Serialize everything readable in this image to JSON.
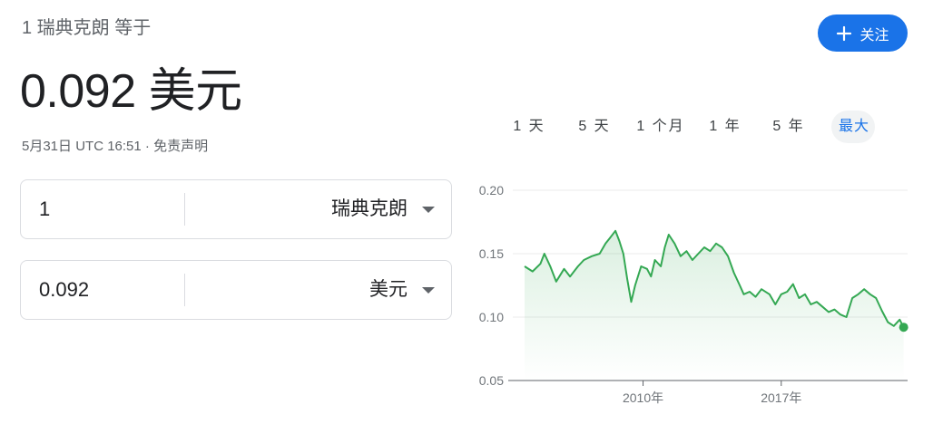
{
  "header": {
    "line": "1 瑞典克朗 等于",
    "rate_value": "0.092",
    "rate_currency": "美元",
    "timestamp": "5月31日 UTC 16:51",
    "separator": " · ",
    "disclaimer": "免责声明"
  },
  "follow_button": {
    "icon": "plus-icon",
    "label": "关注"
  },
  "tabs": [
    {
      "label": "1 天"
    },
    {
      "label": "5 天"
    },
    {
      "label": "1 个月"
    },
    {
      "label": "1 年"
    },
    {
      "label": "5 年"
    },
    {
      "label": "最大",
      "active": true
    }
  ],
  "converter": {
    "from": {
      "amount": "1",
      "currency": "瑞典克朗"
    },
    "to": {
      "amount": "0.092",
      "currency": "美元"
    }
  },
  "colors": {
    "accent": "#1a73e8",
    "line": "#34a853",
    "text": "#202124",
    "muted": "#5f6368"
  },
  "chart_data": {
    "type": "area",
    "y_ticks": [
      "0.20",
      "0.15",
      "0.10",
      "0.05"
    ],
    "x_ticks": [
      "2010年",
      "2017年"
    ],
    "ylim": [
      0.05,
      0.2
    ],
    "xlim": [
      2003.4,
      2023.4
    ],
    "grid": true,
    "series": [
      {
        "x": [
          2004.0,
          2004.4,
          2004.8,
          2005.0,
          2005.3,
          2005.6,
          2006.0,
          2006.3,
          2006.7,
          2007.0,
          2007.4,
          2007.8,
          2008.1,
          2008.3,
          2008.6,
          2008.8,
          2009.0,
          2009.2,
          2009.4,
          2009.6,
          2009.9,
          2010.2,
          2010.4,
          2010.6,
          2010.9,
          2011.1,
          2011.3,
          2011.6,
          2011.9,
          2012.2,
          2012.5,
          2012.8,
          2013.1,
          2013.4,
          2013.7,
          2014.0,
          2014.3,
          2014.6,
          2014.9,
          2015.1,
          2015.4,
          2015.7,
          2016.0,
          2016.4,
          2016.7,
          2017.0,
          2017.3,
          2017.6,
          2017.9,
          2018.2,
          2018.5,
          2018.8,
          2019.1,
          2019.4,
          2019.7,
          2020.0,
          2020.3,
          2020.6,
          2020.9,
          2021.2,
          2021.5,
          2021.8,
          2022.1,
          2022.4,
          2022.7,
          2023.0,
          2023.2
        ],
        "values": [
          0.14,
          0.136,
          0.142,
          0.15,
          0.14,
          0.128,
          0.138,
          0.132,
          0.14,
          0.145,
          0.148,
          0.15,
          0.158,
          0.162,
          0.168,
          0.16,
          0.15,
          0.13,
          0.112,
          0.125,
          0.14,
          0.138,
          0.132,
          0.145,
          0.14,
          0.155,
          0.165,
          0.158,
          0.148,
          0.152,
          0.145,
          0.15,
          0.155,
          0.152,
          0.158,
          0.155,
          0.148,
          0.135,
          0.125,
          0.118,
          0.12,
          0.116,
          0.122,
          0.118,
          0.11,
          0.118,
          0.12,
          0.126,
          0.115,
          0.118,
          0.11,
          0.112,
          0.108,
          0.104,
          0.106,
          0.102,
          0.1,
          0.115,
          0.118,
          0.122,
          0.118,
          0.115,
          0.105,
          0.096,
          0.093,
          0.098,
          0.092
        ]
      }
    ]
  }
}
